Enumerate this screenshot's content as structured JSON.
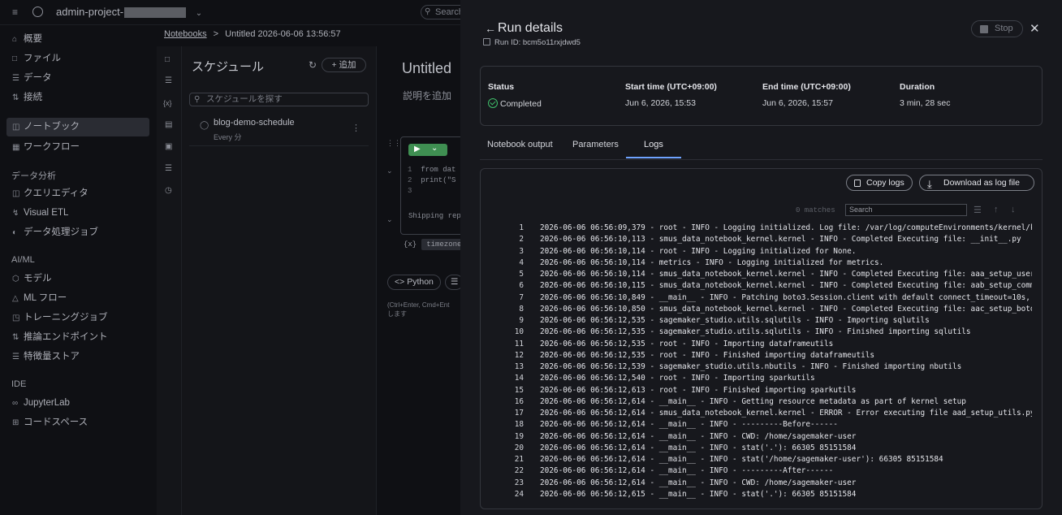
{
  "topbar": {
    "project_prefix": "admin-project-",
    "search_placeholder": "Search"
  },
  "nav": {
    "items": [
      {
        "label": "概要",
        "icon": "home-icon"
      },
      {
        "label": "ファイル",
        "icon": "file-icon"
      },
      {
        "label": "データ",
        "icon": "database-icon"
      },
      {
        "label": "接続",
        "icon": "link-icon"
      },
      {
        "label": "ノートブック",
        "icon": "notebook-icon",
        "active": true
      },
      {
        "label": "ワークフロー",
        "icon": "workflow-icon"
      }
    ],
    "analytics_header": "データ分析",
    "analytics_items": [
      {
        "label": "クエリエディタ",
        "icon": "query-icon"
      },
      {
        "label": "Visual ETL",
        "icon": "etl-icon"
      },
      {
        "label": "データ処理ジョブ",
        "icon": "job-icon"
      }
    ],
    "aiml_header": "AI/ML",
    "aiml_items": [
      {
        "label": "モデル",
        "icon": "model-icon"
      },
      {
        "label": "ML フロー",
        "icon": "flow-icon"
      },
      {
        "label": "トレーニングジョブ",
        "icon": "training-icon"
      },
      {
        "label": "推論エンドポイント",
        "icon": "endpoint-icon"
      },
      {
        "label": "特徴量ストア",
        "icon": "feature-icon"
      }
    ],
    "ide_header": "IDE",
    "ide_items": [
      {
        "label": "JupyterLab",
        "icon": "jupyter-icon"
      },
      {
        "label": "コードスペース",
        "icon": "codespace-icon"
      }
    ]
  },
  "breadcrumb": {
    "root": "Notebooks",
    "sep": ">",
    "current": "Untitled 2026-06-06 13:56:57"
  },
  "schedule": {
    "title": "スケジュール",
    "add_label": "追加",
    "search_placeholder": "スケジュールを探す",
    "row_name": "blog-demo-schedule",
    "row_sub": "Every 分"
  },
  "notebook": {
    "title": "Untitled",
    "description": "説明を追加",
    "code_line1": "from dat",
    "code_line2": "print(\"S",
    "output": "Shipping rep",
    "tz_label": "{x}",
    "tz_chip": "timezone",
    "python_label": "Python",
    "hint_line1": "(Ctrl+Enter, Cmd+Ent",
    "hint_line2": "します"
  },
  "run": {
    "title": "Run details",
    "run_id": "Run ID: bcm5o11rxjdwd5",
    "stop_label": "Stop",
    "status_label": "Status",
    "status_value": "Completed",
    "start_label": "Start time (UTC+09:00)",
    "start_value": "Jun 6, 2026, 15:53",
    "end_label": "End time (UTC+09:00)",
    "end_value": "Jun 6, 2026, 15:57",
    "duration_label": "Duration",
    "duration_value": "3 min, 28 sec",
    "tabs": [
      "Notebook output",
      "Parameters",
      "Logs"
    ],
    "active_tab": "Logs",
    "copy_logs": "Copy logs",
    "download_logs": "Download as log file",
    "matches": "0 matches",
    "log_search_placeholder": "Search"
  },
  "logs": [
    "2026-06-06 06:56:09,379 - root - INFO - Logging initialized. Log file: /var/log/computeEnvironments/kernel/kerr",
    "2026-06-06 06:56:10,113 - smus_data_notebook_kernel.kernel - INFO - Completed Executing file: __init__.py",
    "2026-06-06 06:56:10,114 - root - INFO - Logging initialized for None.",
    "2026-06-06 06:56:10,114 - metrics - INFO - Logging initialized for metrics.",
    "2026-06-06 06:56:10,114 - smus_data_notebook_kernel.kernel - INFO - Completed Executing file: aaa_setup_userns_",
    "2026-06-06 06:56:10,115 - smus_data_notebook_kernel.kernel - INFO - Completed Executing file: aab_setup_common_",
    "2026-06-06 06:56:10,849 - __main__ - INFO - Patching boto3.Session.client with default connect_timeout=10s, max",
    "2026-06-06 06:56:10,850 - smus_data_notebook_kernel.kernel - INFO - Completed Executing file: aac_setup_boto3_c",
    "2026-06-06 06:56:12,535 - sagemaker_studio.utils.sqlutils - INFO - Importing sqlutils",
    "2026-06-06 06:56:12,535 - sagemaker_studio.utils.sqlutils - INFO - Finished importing sqlutils",
    "2026-06-06 06:56:12,535 - root - INFO - Importing dataframeutils",
    "2026-06-06 06:56:12,535 - root - INFO - Finished importing dataframeutils",
    "2026-06-06 06:56:12,539 - sagemaker_studio.utils.nbutils - INFO - Finished importing nbutils",
    "2026-06-06 06:56:12,540 - root - INFO - Importing sparkutils",
    "2026-06-06 06:56:12,613 - root - INFO - Finished importing sparkutils",
    "2026-06-06 06:56:12,614 - __main__ - INFO - Getting resource metadata as part of kernel setup",
    "2026-06-06 06:56:12,614 - smus_data_notebook_kernel.kernel - ERROR - Error executing file aad_setup_utils.py: E",
    "2026-06-06 06:56:12,614 - __main__ - INFO - ---------Before------",
    "2026-06-06 06:56:12,614 - __main__ - INFO - CWD: /home/sagemaker-user",
    "2026-06-06 06:56:12,614 - __main__ - INFO - stat('.'): 66305 85151584",
    "2026-06-06 06:56:12,614 - __main__ - INFO - stat('/home/sagemaker-user'): 66305 85151584",
    "2026-06-06 06:56:12,614 - __main__ - INFO - ---------After------",
    "2026-06-06 06:56:12,614 - __main__ - INFO - CWD: /home/sagemaker-user",
    "2026-06-06 06:56:12,615 - __main__ - INFO - stat('.'): 66305 85151584"
  ]
}
